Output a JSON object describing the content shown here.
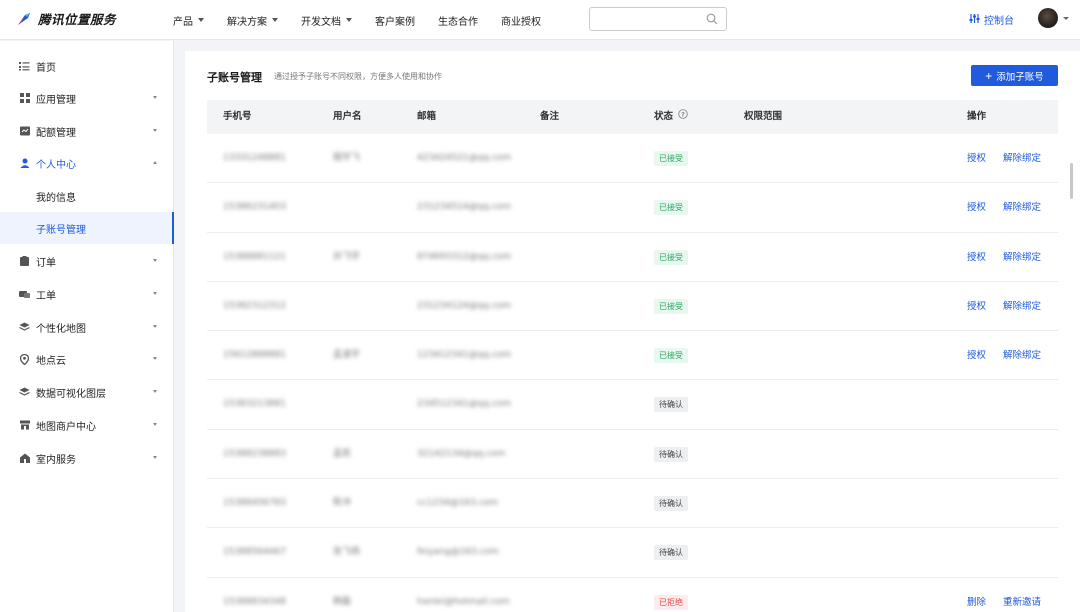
{
  "header": {
    "logo_text": "腾讯位置服务",
    "nav": [
      {
        "label": "产品",
        "dropdown": true
      },
      {
        "label": "解决方案",
        "dropdown": true
      },
      {
        "label": "开发文档",
        "dropdown": true
      },
      {
        "label": "客户案例",
        "dropdown": false
      },
      {
        "label": "生态合作",
        "dropdown": false
      },
      {
        "label": "商业授权",
        "dropdown": false
      }
    ],
    "search_value": "",
    "search_placeholder": "",
    "console_label": "控制台"
  },
  "sidebar": {
    "items": [
      {
        "label": "首页",
        "icon": "list-icon",
        "level": 1
      },
      {
        "label": "应用管理",
        "icon": "grid-icon",
        "level": 1,
        "chevron": "down"
      },
      {
        "label": "配额管理",
        "icon": "quota-icon",
        "level": 1,
        "chevron": "down"
      },
      {
        "label": "个人中心",
        "icon": "user-icon",
        "level": 1,
        "chevron": "up",
        "open": true
      },
      {
        "label": "我的信息",
        "level": 2
      },
      {
        "label": "子账号管理",
        "level": 2,
        "active": true
      },
      {
        "label": "订单",
        "icon": "order-icon",
        "level": 1,
        "chevron": "down"
      },
      {
        "label": "工单",
        "icon": "ticket-icon",
        "level": 1,
        "chevron": "down"
      },
      {
        "label": "个性化地图",
        "icon": "layers-icon",
        "level": 1,
        "chevron": "down"
      },
      {
        "label": "地点云",
        "icon": "pin-icon",
        "level": 1,
        "chevron": "down"
      },
      {
        "label": "数据可视化图层",
        "icon": "layers-icon",
        "level": 1,
        "chevron": "down"
      },
      {
        "label": "地图商户中心",
        "icon": "shop-icon",
        "level": 1,
        "chevron": "down"
      },
      {
        "label": "室内服务",
        "icon": "home-icon",
        "level": 1,
        "chevron": "down"
      }
    ]
  },
  "main": {
    "title": "子账号管理",
    "description": "通过授予子账号不同权限，方便多人使用和协作",
    "add_button": "添加子账号",
    "columns": [
      "手机号",
      "用户名",
      "邮箱",
      "备注",
      "状态",
      "权限范围",
      "操作"
    ],
    "rows": [
      {
        "phone": "13331248881",
        "username": "程宇飞",
        "email": "423424521@qq.com",
        "note": "",
        "status": "已接受",
        "status_type": "ok",
        "actions": [
          "授权",
          "解除绑定"
        ]
      },
      {
        "phone": "15386231403",
        "username": "",
        "email": "231234514@qq.com",
        "note": "",
        "status": "已接受",
        "status_type": "ok",
        "actions": [
          "授权",
          "解除绑定"
        ]
      },
      {
        "phone": "15388881121",
        "username": "孙飞宇",
        "email": "874693312@qq.com",
        "note": "",
        "status": "已接受",
        "status_type": "ok",
        "actions": [
          "授权",
          "解除绑定"
        ]
      },
      {
        "phone": "15382312312",
        "username": "",
        "email": "231234124@qq.com",
        "note": "",
        "status": "已接受",
        "status_type": "ok",
        "actions": [
          "授权",
          "解除绑定"
        ]
      },
      {
        "phone": "15612888881",
        "username": "孟凌宇",
        "email": "123412341@qq.com",
        "note": "",
        "status": "已接受",
        "status_type": "ok",
        "actions": [
          "授权",
          "解除绑定"
        ]
      },
      {
        "phone": "15383213881",
        "username": "",
        "email": "234512341@qq.com",
        "note": "",
        "status": "待确认",
        "status_type": "wait",
        "actions": []
      },
      {
        "phone": "15388238883",
        "username": "孟凯",
        "email": "32142134@qq.com",
        "note": "",
        "status": "待确认",
        "status_type": "wait",
        "actions": []
      },
      {
        "phone": "15388456783",
        "username": "陈冲",
        "email": "cc1234@163.com",
        "note": "",
        "status": "待确认",
        "status_type": "wait",
        "actions": []
      },
      {
        "phone": "15388564467",
        "username": "张飞扬",
        "email": "feiyang@163.com",
        "note": "",
        "status": "待确认",
        "status_type": "wait",
        "actions": []
      },
      {
        "phone": "15388834348",
        "username": "韩磊",
        "email": "hanlei@hotmail.com",
        "note": "",
        "status": "已拒绝",
        "status_type": "rej",
        "actions": [
          "删除",
          "重新邀请"
        ]
      }
    ]
  },
  "colors": {
    "accent": "#1f5bdc",
    "accepted": "#2aa660",
    "rejected": "#e34d4d"
  }
}
